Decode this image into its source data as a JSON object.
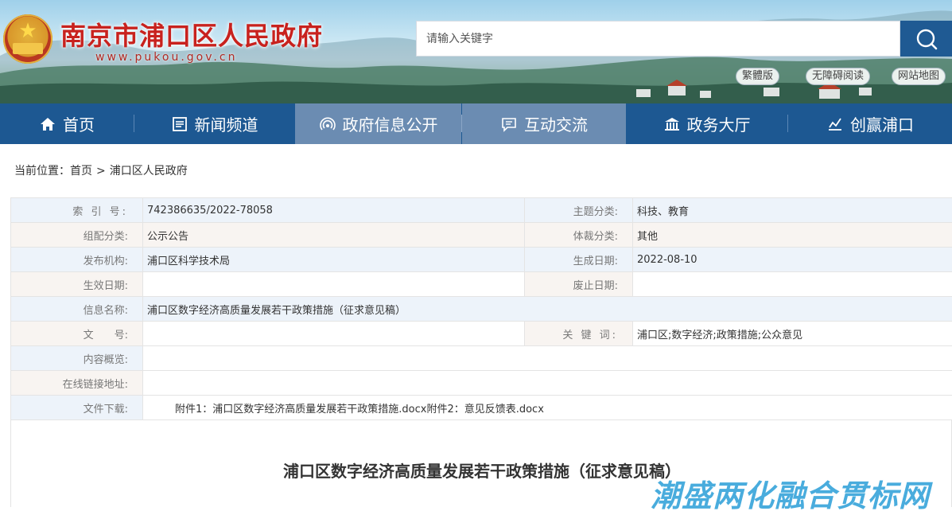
{
  "header": {
    "site_title": "南京市浦口区人民政府",
    "site_domain": "www.pukou.gov.cn",
    "search_placeholder": "请输入关键字",
    "links": [
      "繁體版",
      "无障碍阅读",
      "网站地图"
    ]
  },
  "nav": {
    "items": [
      {
        "label": "首页",
        "icon": "home-icon"
      },
      {
        "label": "新闻频道",
        "icon": "news-icon"
      },
      {
        "label": "政府信息公开",
        "icon": "signal-icon"
      },
      {
        "label": "互动交流",
        "icon": "chat-icon"
      },
      {
        "label": "政务大厅",
        "icon": "building-icon"
      },
      {
        "label": "创赢浦口",
        "icon": "chart-icon"
      }
    ],
    "active_index": [
      2,
      3
    ]
  },
  "breadcrumb": {
    "prefix": "当前位置：",
    "items": [
      "首页",
      "浦口区人民政府"
    ],
    "separator": ">"
  },
  "info": {
    "index_label": "索 引 号:",
    "index_value": "742386635/2022-78058",
    "topic_label": "主题分类:",
    "topic_value": "科技、教育",
    "group_label": "组配分类:",
    "group_value": "公示公告",
    "genre_label": "体裁分类:",
    "genre_value": "其他",
    "org_label": "发布机构:",
    "org_value": "浦口区科学技术局",
    "created_label": "生成日期:",
    "created_value": "2022-08-10",
    "effective_label": "生效日期:",
    "effective_value": "",
    "expire_label": "废止日期:",
    "expire_value": "",
    "name_label": "信息名称:",
    "name_value": "浦口区数字经济高质量发展若干政策措施（征求意见稿）",
    "docno_label": "文　　号:",
    "docno_value": "",
    "keywords_label": "关 键 词:",
    "keywords_value": "浦口区;数字经济;政策措施;公众意见",
    "summary_label": "内容概览:",
    "summary_value": "",
    "link_label": "在线链接地址:",
    "link_value": "",
    "download_label": "文件下载:",
    "attachments": [
      "附件1：浦口区数字经济高质量发展若干政策措施.docx",
      "附件2：意见反馈表.docx"
    ]
  },
  "article": {
    "title": "浦口区数字经济高质量发展若干政策措施（征求意见稿）"
  },
  "watermark": "潮盛两化融合贯标网",
  "colors": {
    "nav_bg": "#1d5892",
    "nav_active": "#6b8cb2",
    "title_red": "#c8221e",
    "row_blue": "#edf3fa",
    "row_beige": "#f8f4f1",
    "watermark": "#3aa6db"
  }
}
